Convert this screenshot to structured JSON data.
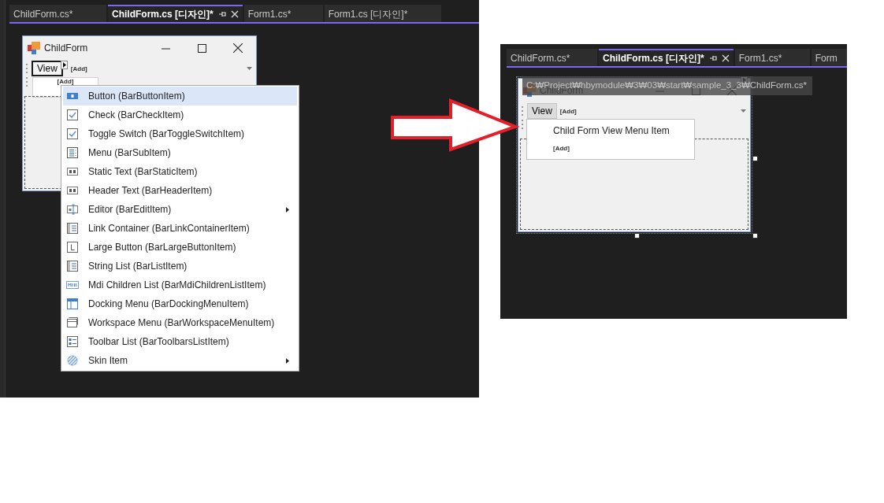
{
  "left_screen": {
    "tabs": [
      {
        "label": "ChildForm.cs*",
        "selected": false
      },
      {
        "label": "ChildForm.cs [디자인]*",
        "selected": true
      },
      {
        "label": "Form1.cs*",
        "selected": false
      },
      {
        "label": "Form1.cs [디자인]*",
        "selected": false
      }
    ],
    "form": {
      "title": "ChildForm",
      "menu_bar": {
        "items": [
          {
            "label": "View",
            "selected": true,
            "pressed": false
          }
        ],
        "add_label": "[Add]"
      },
      "submenu_add": "[Add]"
    },
    "popup_menu": {
      "items": [
        {
          "label": "Button (BarButtonItem)",
          "selected": true,
          "has_submenu": false
        },
        {
          "label": "Check (BarCheckItem)",
          "selected": false,
          "has_submenu": false
        },
        {
          "label": "Toggle Switch (BarToggleSwitchItem)",
          "selected": false,
          "has_submenu": false
        },
        {
          "label": "Menu (BarSubItem)",
          "selected": false,
          "has_submenu": false
        },
        {
          "label": "Static Text (BarStaticItem)",
          "selected": false,
          "has_submenu": false
        },
        {
          "label": "Header Text (BarHeaderItem)",
          "selected": false,
          "has_submenu": false
        },
        {
          "label": "Editor (BarEditItem)",
          "selected": false,
          "has_submenu": true
        },
        {
          "label": "Link Container (BarLinkContainerItem)",
          "selected": false,
          "has_submenu": false
        },
        {
          "label": "Large Button (BarLargeButtonItem)",
          "selected": false,
          "has_submenu": false
        },
        {
          "label": "String List (BarListItem)",
          "selected": false,
          "has_submenu": false
        },
        {
          "label": "Mdi Children List (BarMdiChildrenListItem)",
          "selected": false,
          "has_submenu": false
        },
        {
          "label": "Docking Menu (BarDockingMenuItem)",
          "selected": false,
          "has_submenu": false
        },
        {
          "label": "Workspace Menu (BarWorkspaceMenuItem)",
          "selected": false,
          "has_submenu": false
        },
        {
          "label": "Toolbar List (BarToolbarsListItem)",
          "selected": false,
          "has_submenu": false
        },
        {
          "label": "Skin Item",
          "selected": false,
          "has_submenu": true
        }
      ]
    }
  },
  "right_screen": {
    "tabs": [
      {
        "label": "ChildForm.cs*",
        "selected": false
      },
      {
        "label": "ChildForm.cs [디자인]*",
        "selected": true
      },
      {
        "label": "Form1.cs*",
        "selected": false
      },
      {
        "label": "Form",
        "selected": false
      }
    ],
    "tooltip": "C:₩Project₩hbymodule₩3₩03₩start₩sample_3_3₩ChildForm.cs*",
    "form": {
      "title": "ChildForm",
      "menu_bar": {
        "items": [
          {
            "label": "View",
            "selected": false,
            "pressed": true
          }
        ],
        "add_label": "[Add]"
      }
    },
    "dropdown": {
      "items": [
        {
          "label": "Child Form View Menu Item",
          "kind": "item"
        },
        {
          "label": "[Add]",
          "kind": "add"
        }
      ]
    }
  }
}
